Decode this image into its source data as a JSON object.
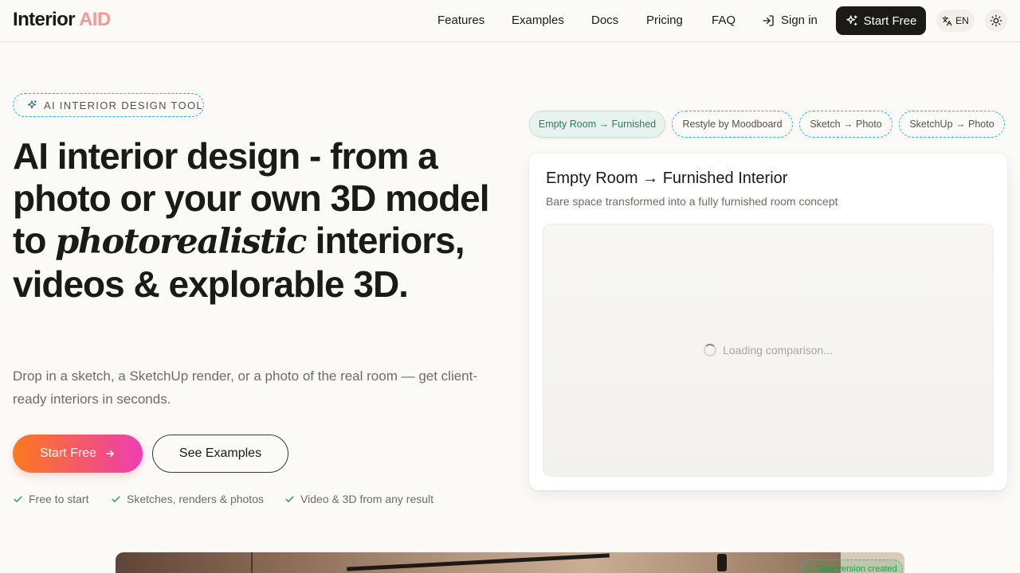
{
  "header": {
    "logo_main": "Interior",
    "logo_accent": "AID",
    "nav": [
      "Features",
      "Examples",
      "Docs",
      "Pricing",
      "FAQ"
    ],
    "signin": "Sign in",
    "start_free": "Start Free",
    "lang": "EN"
  },
  "hero": {
    "badge": "AI INTERIOR DESIGN TOOL",
    "title_part1": "AI interior design - from a photo or your own 3D model to ",
    "title_italic": "photorealistic",
    "title_part2": " interiors, videos & explorable 3D.",
    "subtitle": "Drop in a sketch, a SketchUp render, or a photo of the real room — get client-ready interiors in seconds.",
    "cta_primary": "Start Free",
    "cta_secondary": "See Examples",
    "perks": [
      "Free to start",
      "Sketches, renders & photos",
      "Video & 3D from any result"
    ]
  },
  "tabs": [
    {
      "label": "Empty Room → Furnished",
      "active": true
    },
    {
      "label": "Restyle by Moodboard",
      "active": false
    },
    {
      "label": "Sketch → Photo",
      "active": false
    },
    {
      "label": "SketchUp → Photo",
      "active": false
    }
  ],
  "card": {
    "title": "Empty Room → Furnished Interior",
    "subtitle": "Bare space transformed into a fully furnished room concept",
    "loading": "Loading comparison..."
  },
  "preview": {
    "badge": "New version created"
  },
  "colors": {
    "background": "#fbfaf7",
    "text": "#1c1a17",
    "logo_accent": "#f19a98",
    "cta_gradient_start": "#fb7a1c",
    "cta_gradient_end": "#ee3fb0",
    "active_tab": "#e7f3ee"
  },
  "icons": {
    "signin": "log-in-icon",
    "start": "sparkles-icon",
    "lang": "translate-icon",
    "theme": "sun-icon",
    "badge": "sparkle-icon",
    "arrow": "arrow-right-icon",
    "perk": "check-icon",
    "loading": "spinner-icon"
  }
}
